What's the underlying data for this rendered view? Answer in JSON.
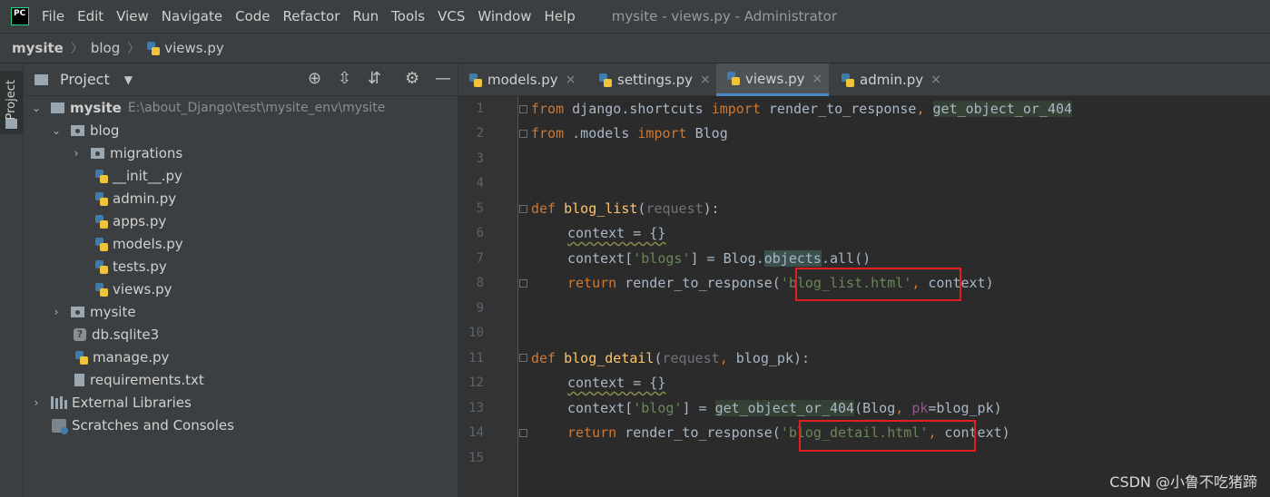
{
  "app": {
    "logo": "PC",
    "window_title": "mysite - views.py - Administrator"
  },
  "menu": [
    "File",
    "Edit",
    "View",
    "Navigate",
    "Code",
    "Refactor",
    "Run",
    "Tools",
    "VCS",
    "Window",
    "Help"
  ],
  "breadcrumb": [
    "mysite",
    "blog",
    "views.py"
  ],
  "side_stripe": {
    "label": "Project"
  },
  "project_panel": {
    "title": "Project",
    "root_name": "mysite",
    "root_path": "E:\\about_Django\\test\\mysite_env\\mysite",
    "items": [
      {
        "label": "blog"
      },
      {
        "label": "migrations"
      },
      {
        "label": "__init__.py"
      },
      {
        "label": "admin.py"
      },
      {
        "label": "apps.py"
      },
      {
        "label": "models.py"
      },
      {
        "label": "tests.py"
      },
      {
        "label": "views.py"
      },
      {
        "label": "mysite"
      },
      {
        "label": "db.sqlite3"
      },
      {
        "label": "manage.py"
      },
      {
        "label": "requirements.txt"
      },
      {
        "label": "External Libraries"
      },
      {
        "label": "Scratches and Consoles"
      }
    ]
  },
  "tabs": [
    {
      "label": "models.py"
    },
    {
      "label": "settings.py"
    },
    {
      "label": "views.py",
      "active": true
    },
    {
      "label": "admin.py"
    }
  ],
  "line_numbers": [
    "1",
    "2",
    "3",
    "4",
    "5",
    "6",
    "7",
    "8",
    "9",
    "10",
    "11",
    "12",
    "13",
    "14",
    "15"
  ],
  "code": {
    "l1": [
      "from",
      " django.shortcuts ",
      "import",
      " render_to_response",
      ", ",
      "get_object_or_404"
    ],
    "l2": [
      "from",
      " .models ",
      "import",
      " Blog"
    ],
    "l5": [
      "def",
      " ",
      "blog_list",
      "(",
      "request",
      "):"
    ],
    "l6": [
      "context = {}"
    ],
    "l7": [
      "context[",
      "'blogs'",
      "] = Blog.",
      "objects",
      ".all()"
    ],
    "l8": [
      "return",
      " render_to_response(",
      "'blog_list.html'",
      ",",
      " context)"
    ],
    "l11": [
      "def",
      " ",
      "blog_detail",
      "(",
      "request",
      ", ",
      "blog_pk",
      "):"
    ],
    "l12": [
      "context = {}"
    ],
    "l13": [
      "context[",
      "'blog'",
      "] = ",
      "get_object_or_404",
      "(Blog",
      ", ",
      "pk",
      "=blog_pk)"
    ],
    "l14": [
      "return",
      " render_to_response(",
      "'blog_detail.html'",
      ",",
      " context)"
    ]
  },
  "watermark": "CSDN @小鲁不吃猪蹄",
  "colors": {
    "highlight_box": "#e02020",
    "active_tab_underline": "#4a88c7"
  }
}
